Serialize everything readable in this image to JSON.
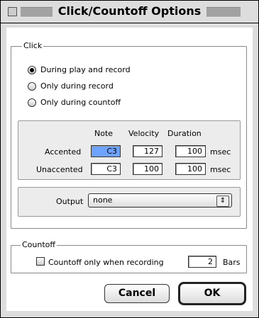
{
  "window": {
    "title": "Click/Countoff Options"
  },
  "click": {
    "group_label": "Click",
    "options": [
      {
        "label": "During play and record",
        "selected": true
      },
      {
        "label": "Only during record",
        "selected": false
      },
      {
        "label": "Only during countoff",
        "selected": false
      }
    ],
    "headers": {
      "note": "Note",
      "velocity": "Velocity",
      "duration": "Duration"
    },
    "rows": [
      {
        "label": "Accented",
        "note": "C3",
        "velocity": "127",
        "duration": "100",
        "unit": "msec"
      },
      {
        "label": "Unaccented",
        "note": "C3",
        "velocity": "100",
        "duration": "100",
        "unit": "msec"
      }
    ],
    "output": {
      "label": "Output",
      "value": "none"
    }
  },
  "countoff": {
    "group_label": "Countoff",
    "checkbox_label": "Countoff only when recording",
    "checked": false,
    "bars_value": "2",
    "bars_label": "Bars"
  },
  "buttons": {
    "cancel": "Cancel",
    "ok": "OK"
  }
}
